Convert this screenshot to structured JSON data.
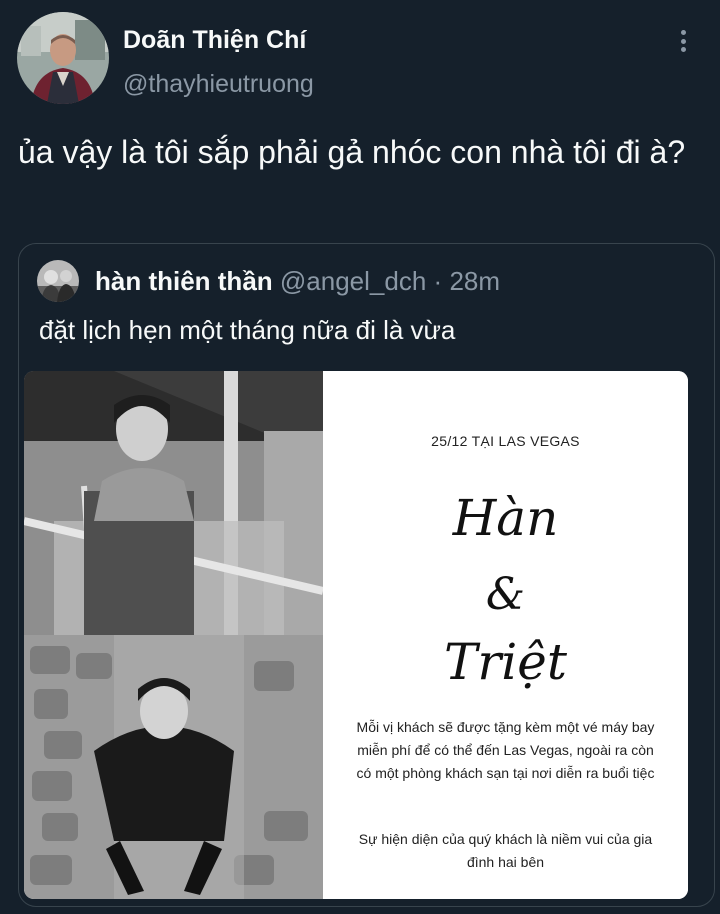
{
  "tweet": {
    "author_name": "Doãn Thiện Chí",
    "author_handle": "@thayhieutruong",
    "text": "ủa vậy là tôi sắp phải gả nhóc con nhà tôi đi à?"
  },
  "quoted": {
    "author_name": "hàn thiên thần",
    "author_handle": "@angel_dch",
    "separator": "·",
    "time": "28m",
    "text": "đặt lịch hẹn một tháng nữa đi là vừa"
  },
  "invitation": {
    "date_line": "25/12 TẠI LAS VEGAS",
    "name_1": "Hàn",
    "ampersand": "&",
    "name_2": "Triệt",
    "paragraph_1": "Mỗi vị khách sẽ được tặng kèm một vé máy bay miễn phí để có thể đến Las Vegas, ngoài ra còn có một phòng khách sạn tại nơi diễn ra buổi tiệc",
    "paragraph_2": "Sự hiện diện của quý khách là niềm vui của gia đình hai bên"
  },
  "colors": {
    "background": "#15202b",
    "primary_text": "#f7f9f9",
    "secondary_text": "#8b98a5",
    "border": "#38444d"
  },
  "icons": {
    "more_menu": "more-vertical-icon"
  }
}
